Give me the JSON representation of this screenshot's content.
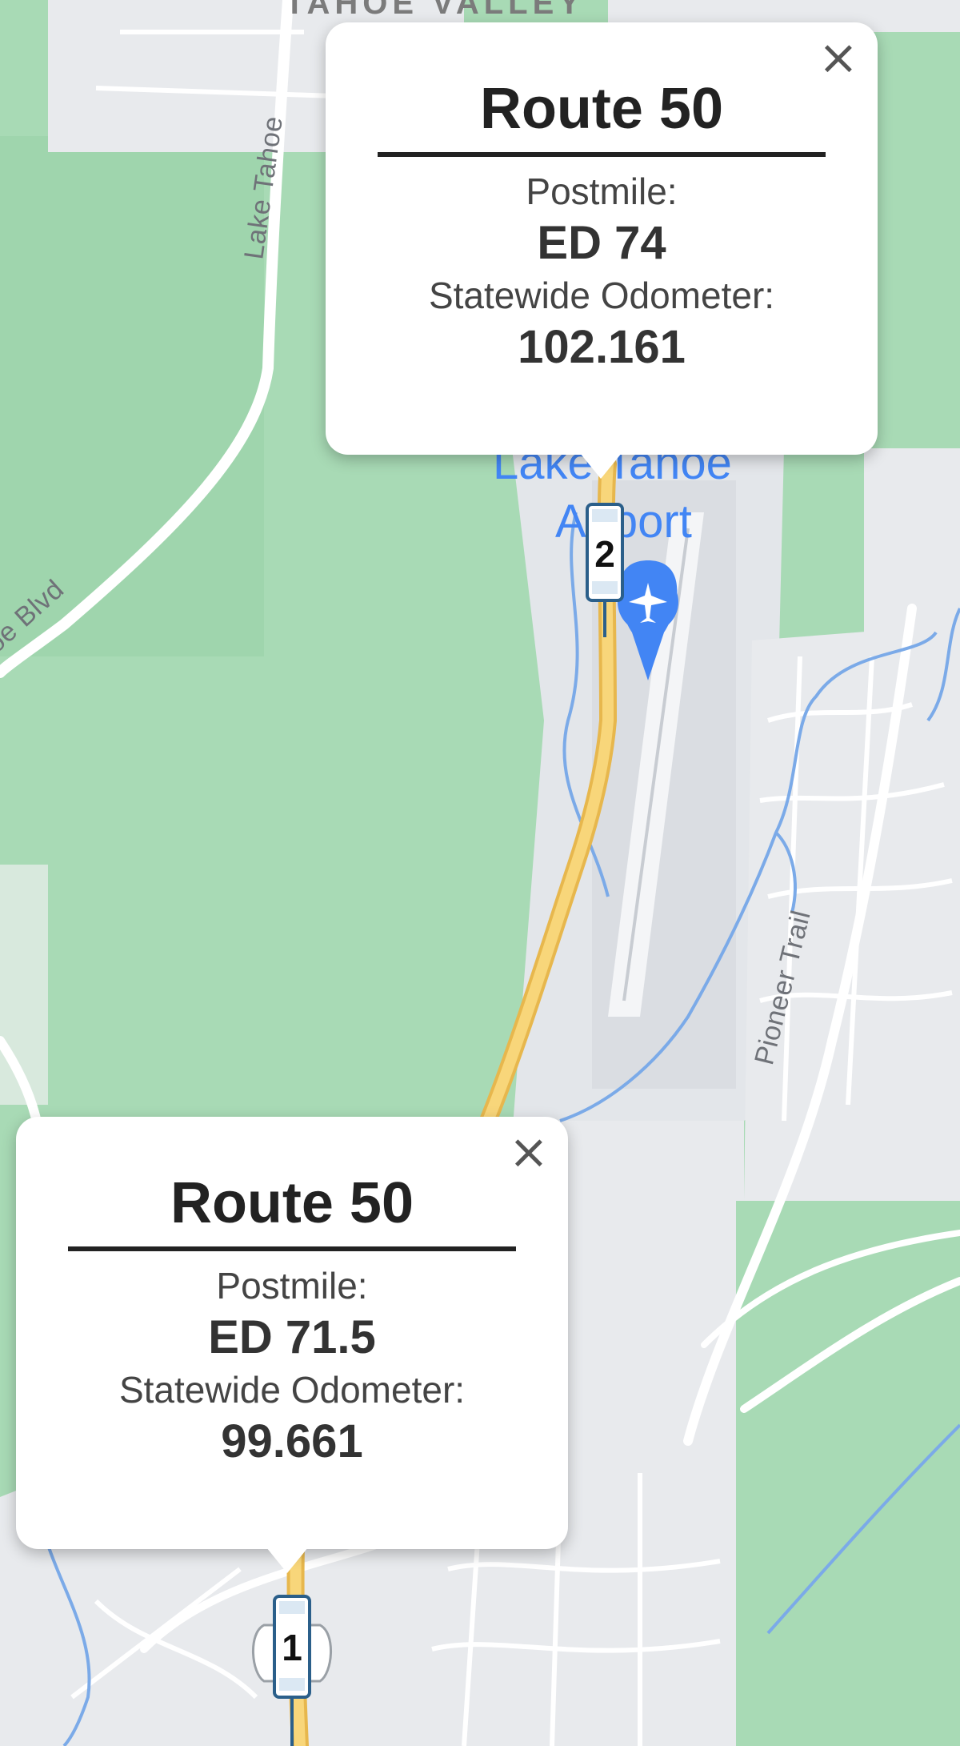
{
  "map": {
    "place_label": "TAHOE VALLEY",
    "road_labels": {
      "lake_tahoe_blvd_vertical": "Lake Tahoe",
      "tahoe_blvd_diagonal": "oe Blvd",
      "pioneer_trail": "Pioneer Trail"
    },
    "airport_label_line1": "Lake Tahoe",
    "airport_label_line2": "Airport",
    "airport_icon": "airplane-icon",
    "colors": {
      "park_green": "#a8dab5",
      "urban_gray": "#e8eaed",
      "highway": "#f8c967",
      "water": "#7baae8",
      "airport_blue": "#4285f4"
    }
  },
  "popups": [
    {
      "route_title": "Route 50",
      "postmile_label": "Postmile:",
      "postmile_value": "ED 74",
      "odometer_label": "Statewide Odometer:",
      "odometer_value": "102.161",
      "close_glyph": "×"
    },
    {
      "route_title": "Route 50",
      "postmile_label": "Postmile:",
      "postmile_value": "ED 71.5",
      "odometer_label": "Statewide Odometer:",
      "odometer_value": "99.661",
      "close_glyph": "×"
    }
  ],
  "markers": [
    {
      "number": "2",
      "icon": "postmile-marker-icon"
    },
    {
      "number": "1",
      "icon": "postmile-marker-icon"
    }
  ]
}
